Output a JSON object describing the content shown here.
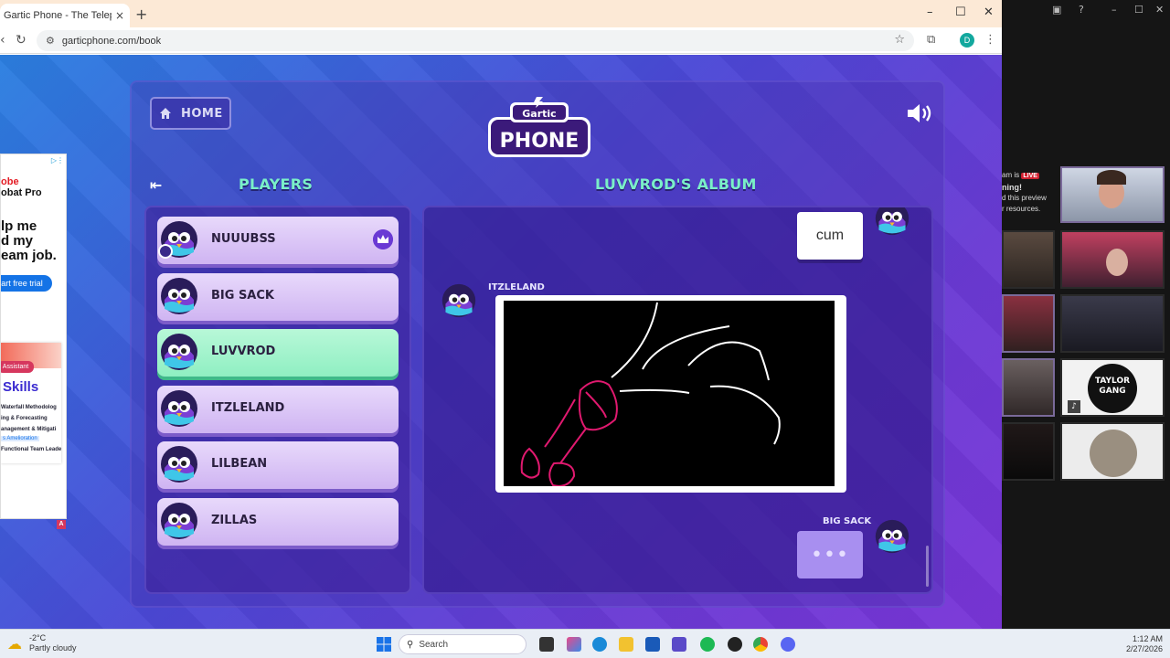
{
  "browser": {
    "tab_title": "Gartic Phone - The Telephone G",
    "tab_close": "×",
    "new_tab": "+",
    "url": "garticphone.com/book",
    "profile_initial": "D"
  },
  "ad": {
    "brand_line1": "obe",
    "brand_line2": "obat Pro",
    "headline": [
      "lp me",
      "d my",
      "eam job."
    ],
    "cta": "art free trial",
    "badge": "Assistant",
    "skills": "Skills",
    "lines": [
      "Waterfall Methodolog",
      "ing & Forecasting",
      "anagement & Mitigati",
      "Functional Team Leade"
    ],
    "tag": "s Amelioration",
    "marker": "A"
  },
  "game": {
    "home_label": "HOME",
    "logo_top": "Gartic",
    "logo_bottom": "PHONE",
    "players_title": "PLAYERS",
    "album_title": "LUVVROD'S ALBUM",
    "players": [
      {
        "name": "NUUUBSS",
        "host": true
      },
      {
        "name": "BIG SACK",
        "host": false
      },
      {
        "name": "LUVVROD",
        "host": false
      },
      {
        "name": "ITZLELAND",
        "host": false
      },
      {
        "name": "LILBEAN",
        "host": false
      },
      {
        "name": "ZILLAS",
        "host": false
      }
    ],
    "active_player": "LUVVROD",
    "album": {
      "first_text": "cum",
      "drawing_author": "ITZLELAND",
      "typing_author": "BIG SACK",
      "typing_dots": "•••"
    }
  },
  "side": {
    "notice_line1": "am is",
    "live": "LIVE",
    "notice_line2": "ning!",
    "notice_line3": "d this preview",
    "notice_line4": "r resources.",
    "gang_text1": "TAYLOR",
    "gang_text2": "GANG"
  },
  "taskbar": {
    "temp": "-2°C",
    "weather": "Partly cloudy",
    "search": "Search",
    "time": "1:12 AM",
    "date": "2/27/2026"
  },
  "colors": {
    "accent_green": "#7af0c8",
    "player_card": "#dcc8f7",
    "active_card": "#a6f3cd",
    "drawing_pink": "#e0196f"
  }
}
